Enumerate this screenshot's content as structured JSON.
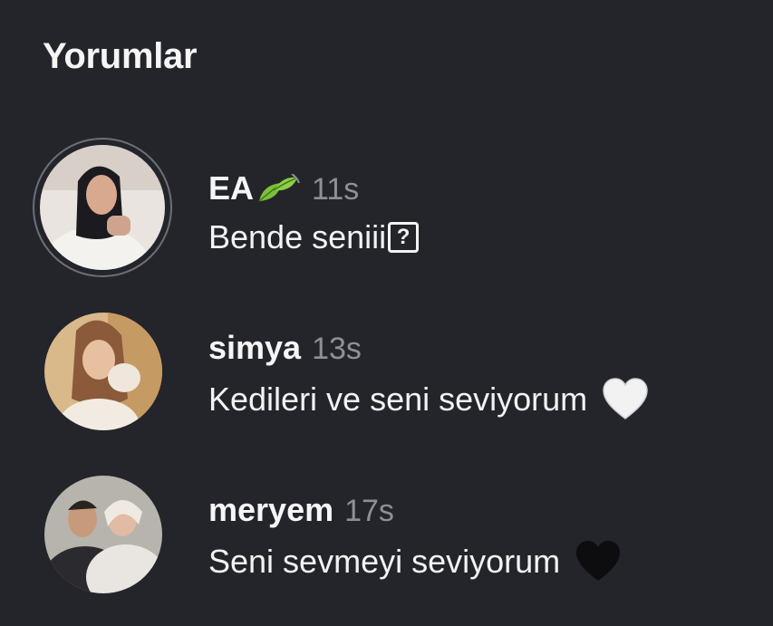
{
  "header": {
    "title": "Yorumlar"
  },
  "comments": [
    {
      "username": "EA",
      "time": "11s",
      "text": "Bende seniii",
      "emoji_icon": "leaf-icon",
      "trailing_icon": "unknown-glyph-icon",
      "has_story_ring": true
    },
    {
      "username": "simya",
      "time": "13s",
      "text": "Kedileri ve seni seviyorum",
      "trailing_icon": "white-heart-icon"
    },
    {
      "username": "meryem",
      "time": "17s",
      "text": "Seni sevmeyi seviyorum",
      "trailing_icon": "black-heart-icon"
    }
  ],
  "colors": {
    "background": "#23252b",
    "muted": "#8e9098",
    "text": "#f3f3f4"
  }
}
